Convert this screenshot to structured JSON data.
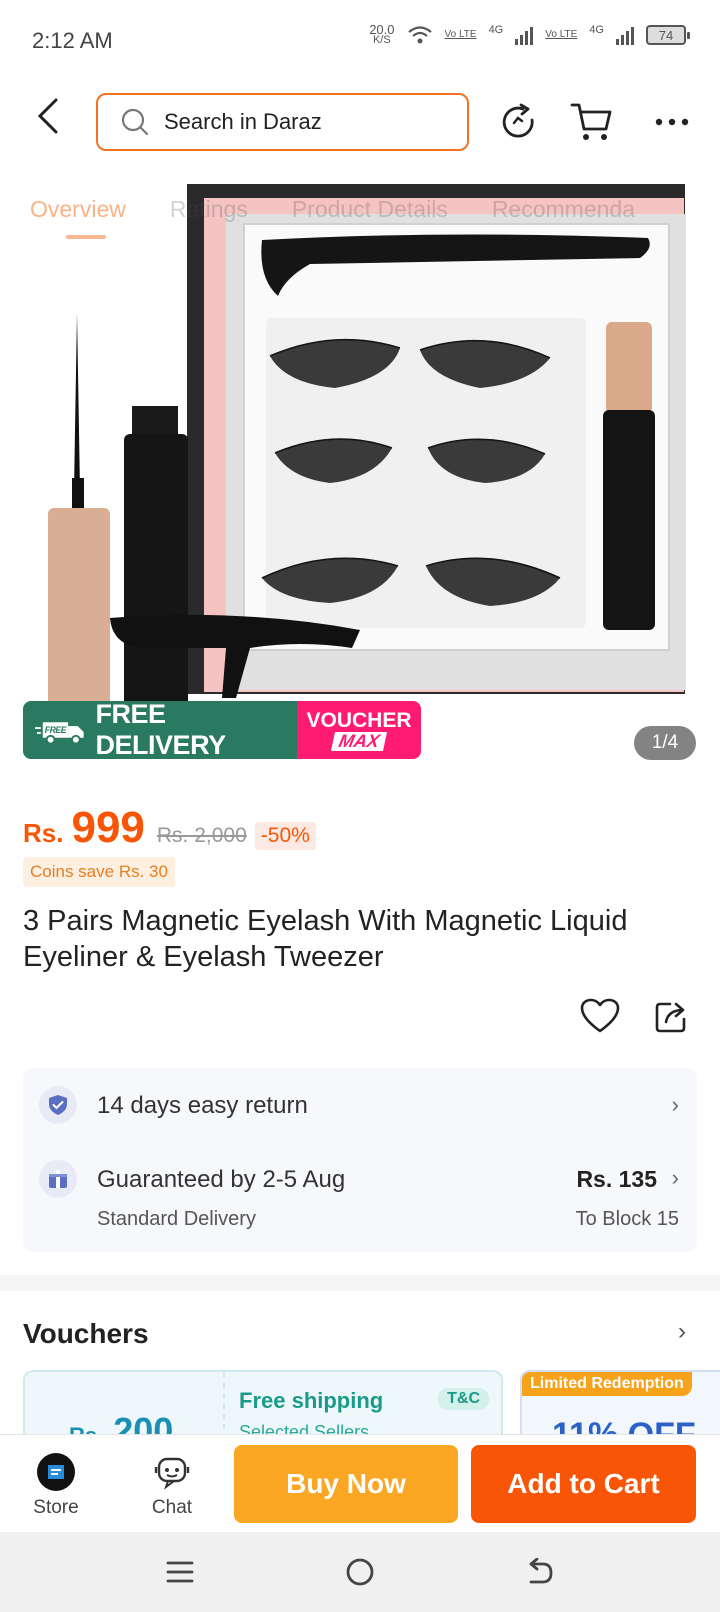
{
  "status_bar": {
    "time": "2:12 AM",
    "net_speed": "20.0",
    "net_unit": "K/S",
    "volte1": "Vo LTE",
    "sig1": "4G",
    "volte2": "Vo LTE",
    "sig2": "4G",
    "battery": "74"
  },
  "header": {
    "search_placeholder": "Search in Daraz",
    "icons": [
      "back-icon",
      "search-icon",
      "refresh-icon",
      "cart-icon",
      "more-icon"
    ]
  },
  "tabs": [
    "Overview",
    "Ratings",
    "Product Details",
    "Recommenda"
  ],
  "gallery": {
    "free_delivery_badge": "FREE",
    "free_delivery": "FREE DELIVERY",
    "voucher_line1": "VOUCHER",
    "voucher_line2": "MAX",
    "pager": "1/4"
  },
  "product": {
    "currency": "Rs.",
    "price": "999",
    "old_price": "Rs. 2,000",
    "discount": "-50%",
    "coins": "Coins save Rs. 30",
    "title": "3 Pairs Magnetic Eyelash With Magnetic Liquid Eyeliner & Eyelash Tweezer"
  },
  "service": {
    "return_text": "14 days easy return",
    "delivery_text": "Guaranteed by 2-5 Aug",
    "delivery_sub": "Standard Delivery",
    "delivery_fee": "Rs. 135",
    "delivery_dest": "To Block 15"
  },
  "vouchers": {
    "title": "Vouchers",
    "card1": {
      "amount_cur": "Rs.",
      "amount": "200",
      "title": "Free shipping",
      "sub": "Selected Sellers",
      "tc": "T&C"
    },
    "card2": {
      "tag": "Limited Redemption",
      "amount": "11% OFF"
    }
  },
  "bottom_bar": {
    "store": "Store",
    "chat": "Chat",
    "buy_now": "Buy Now",
    "add_to_cart": "Add to Cart"
  },
  "colors": {
    "accent": "#f85606",
    "buy_now": "#fca724",
    "search_border": "#f57224"
  }
}
